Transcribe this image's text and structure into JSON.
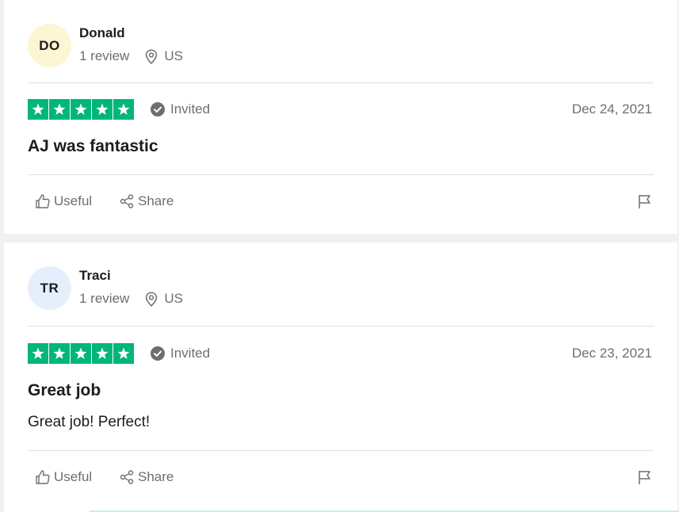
{
  "colors": {
    "star_green": "#00b67a",
    "muted_text": "#6d6d75",
    "avatar_yellow": "#fcf6d4",
    "avatar_blue": "#e5effb"
  },
  "reviews": [
    {
      "initials": "DO",
      "name": "Donald",
      "review_count": "1 review",
      "location": "US",
      "rating": 5,
      "verification": "Invited",
      "date": "Dec 24, 2021",
      "title": "AJ was fantastic",
      "text": "",
      "useful_label": "Useful",
      "share_label": "Share"
    },
    {
      "initials": "TR",
      "name": "Traci",
      "review_count": "1 review",
      "location": "US",
      "rating": 5,
      "verification": "Invited",
      "date": "Dec 23, 2021",
      "title": "Great job",
      "text": "Great job! Perfect!",
      "useful_label": "Useful",
      "share_label": "Share"
    }
  ]
}
